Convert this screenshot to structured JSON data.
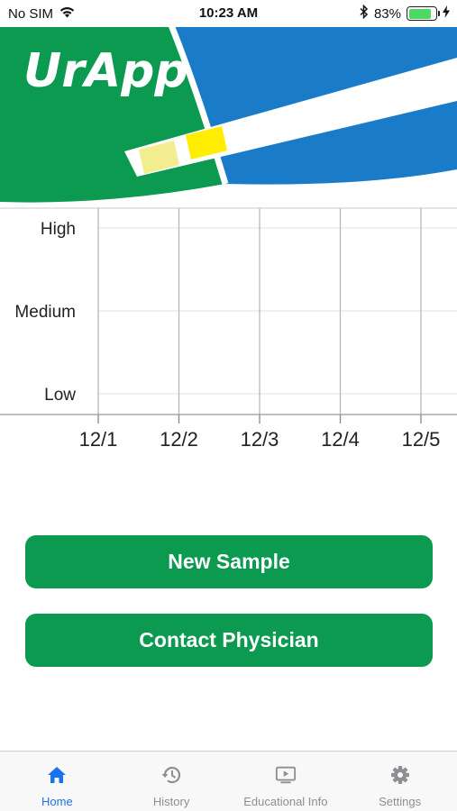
{
  "status_bar": {
    "carrier": "No SIM",
    "time": "10:23 AM",
    "battery_percent": "83%",
    "battery_level": 0.83,
    "icons": [
      "wifi-icon",
      "bluetooth-icon",
      "battery-icon",
      "charging-icon"
    ]
  },
  "header": {
    "app_name": "UrApp",
    "colors": {
      "green": "#0b9a50",
      "blue": "#1a7cc8",
      "strip_pad_light": "#f2ee90",
      "strip_pad_yellow": "#ffee00"
    }
  },
  "chart_data": {
    "type": "line",
    "categories": [
      "12/1",
      "12/2",
      "12/3",
      "12/4",
      "12/5"
    ],
    "y_levels": [
      "Low",
      "Medium",
      "High"
    ],
    "series": [],
    "grid": true
  },
  "actions": {
    "new_sample": "New Sample",
    "contact_physician": "Contact Physician",
    "button_color": "#0b9a50"
  },
  "tabs": [
    {
      "label": "Home",
      "icon": "home-icon",
      "active": true
    },
    {
      "label": "History",
      "icon": "history-icon",
      "active": false
    },
    {
      "label": "Educational Info",
      "icon": "video-icon",
      "active": false
    },
    {
      "label": "Settings",
      "icon": "gear-icon",
      "active": false
    }
  ],
  "tab_colors": {
    "active": "#1a73e8",
    "inactive": "#8e8e93"
  }
}
